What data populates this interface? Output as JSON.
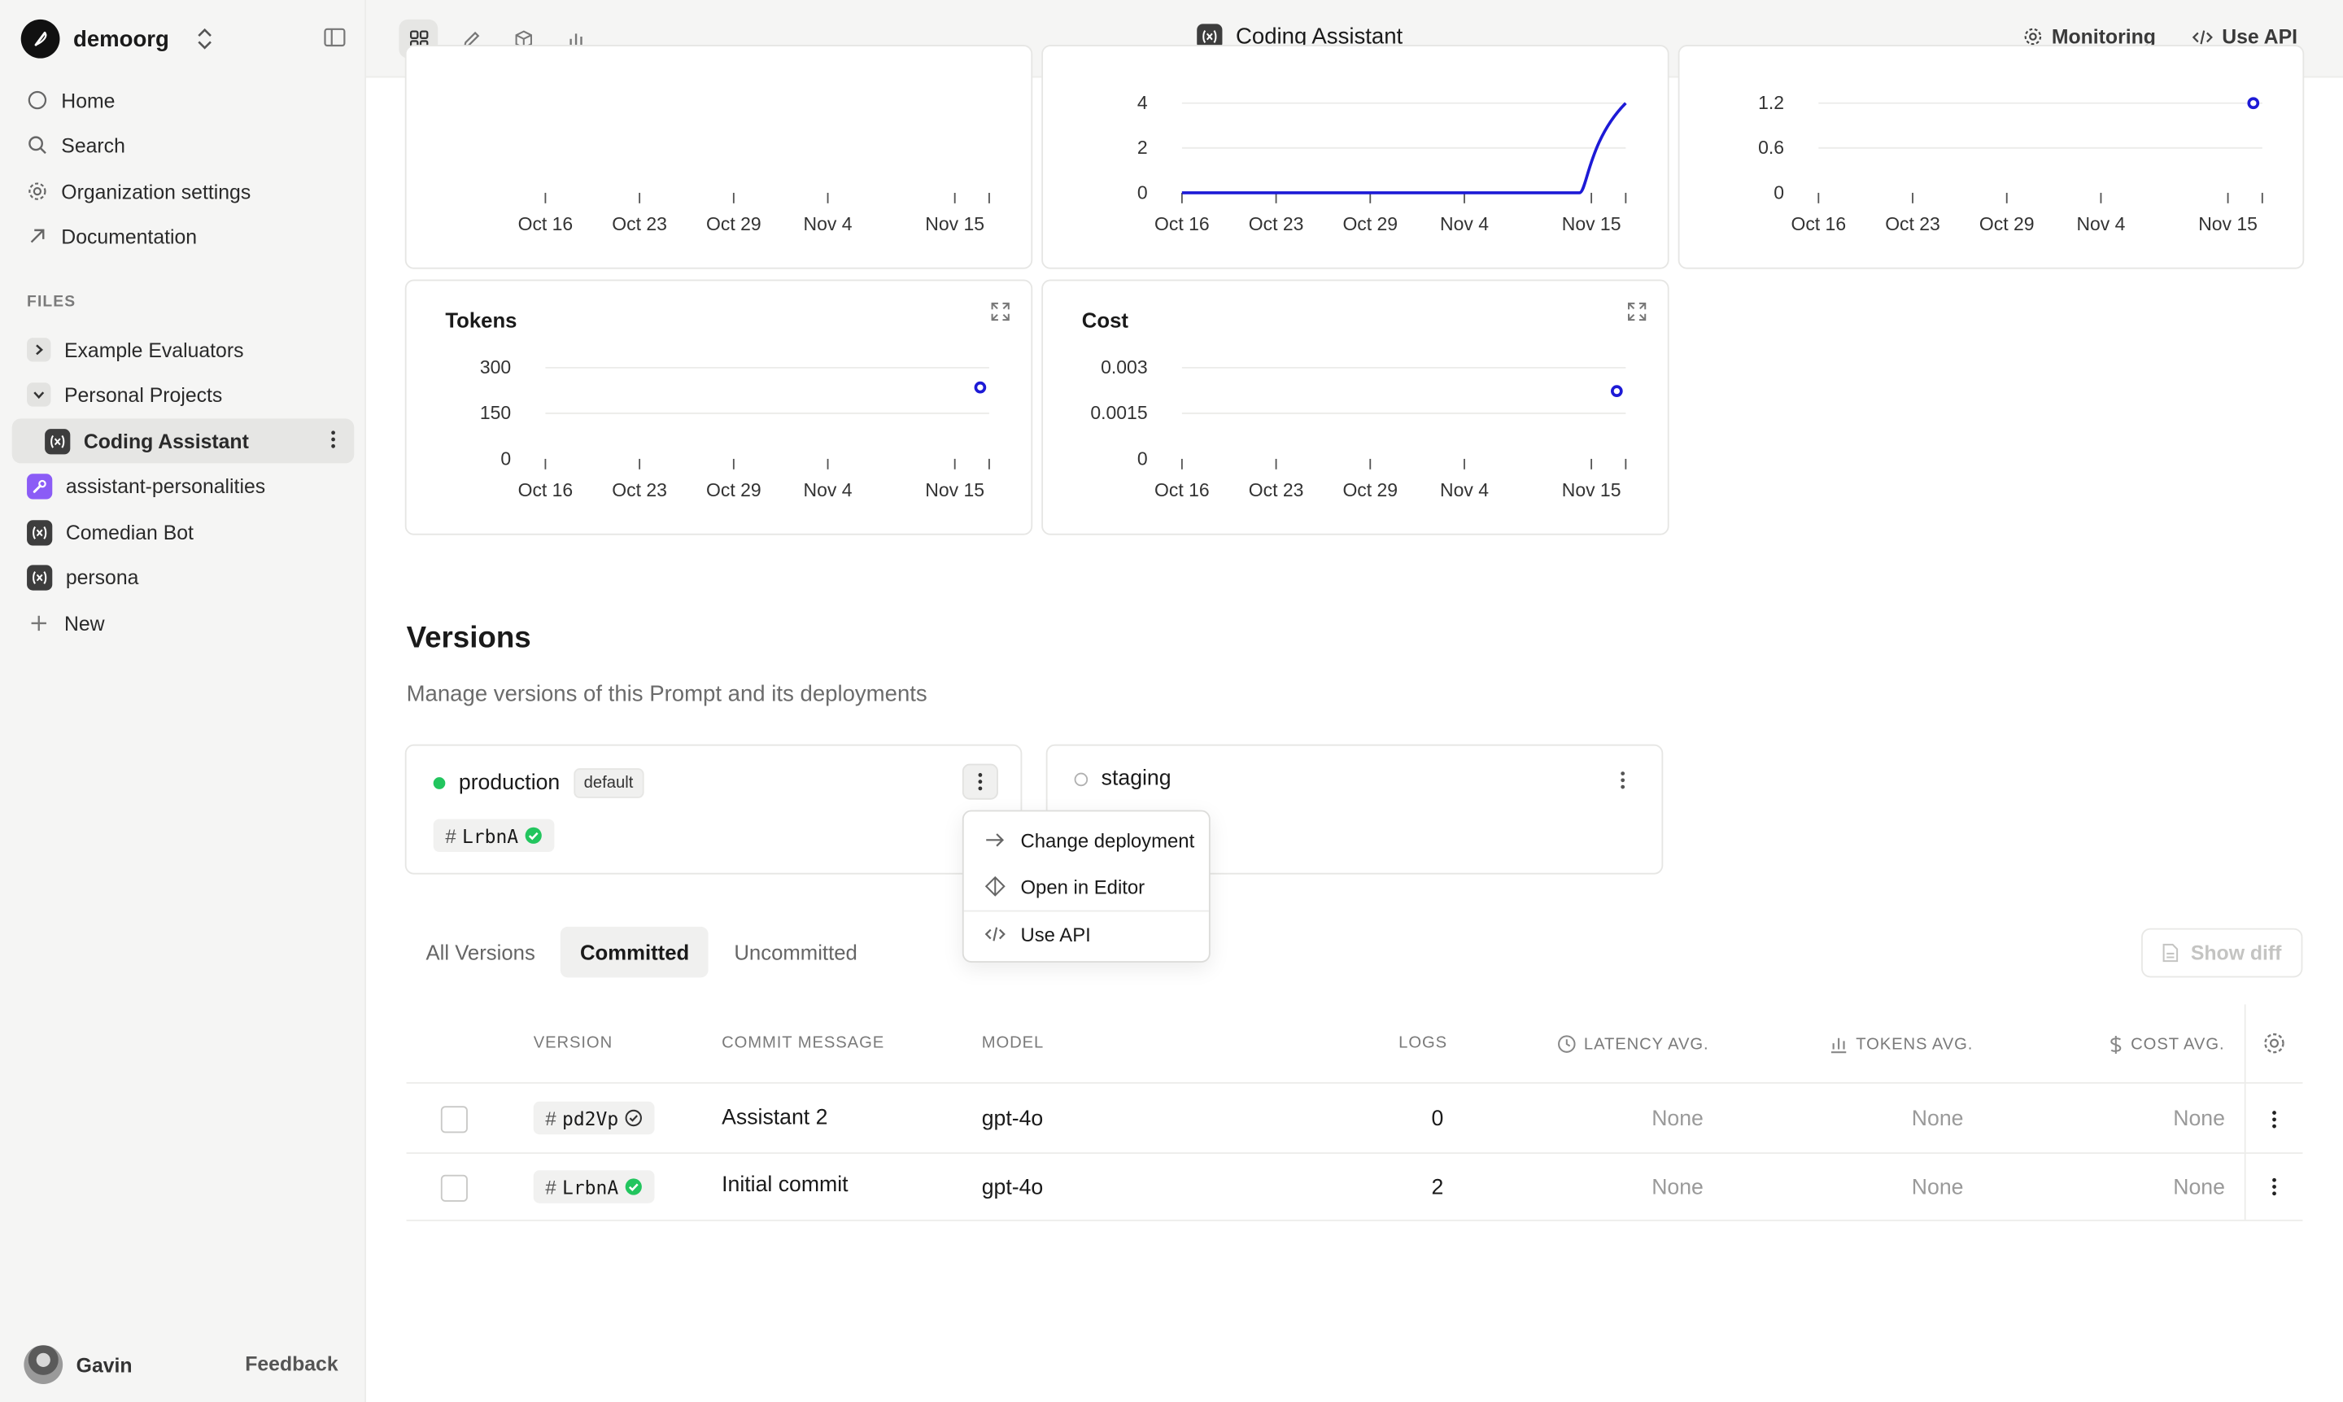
{
  "org": {
    "name": "demoorg"
  },
  "nav": [
    {
      "label": "Home",
      "icon": "circle-icon"
    },
    {
      "label": "Search",
      "icon": "search-icon"
    },
    {
      "label": "Organization settings",
      "icon": "gear-icon"
    },
    {
      "label": "Documentation",
      "icon": "arrow-up-right-icon"
    }
  ],
  "files": {
    "label": "FILES",
    "items": [
      {
        "label": "Example Evaluators",
        "icon": "chevron-right-icon"
      },
      {
        "label": "Personal Projects",
        "icon": "chevron-down-icon"
      },
      {
        "label": "Coding Assistant",
        "icon": "prompt-icon",
        "active": true
      },
      {
        "label": "assistant-personalities",
        "icon": "wrench-icon"
      },
      {
        "label": "Comedian Bot",
        "icon": "prompt-icon"
      },
      {
        "label": "persona",
        "icon": "prompt-icon"
      },
      {
        "label": "New",
        "icon": "plus-icon"
      }
    ]
  },
  "user": {
    "name": "Gavin",
    "feedback": "Feedback"
  },
  "topbar": {
    "title": "Coding Assistant",
    "monitoring": "Monitoring",
    "use_api": "Use API"
  },
  "chart_data": [
    {
      "type": "line",
      "x": [
        "Oct 16",
        "Oct 23",
        "Oct 29",
        "Nov 4",
        "Nov 15"
      ],
      "series": [],
      "xlabel": "",
      "ylabel": ""
    },
    {
      "type": "line",
      "x": [
        "Oct 16",
        "Oct 23",
        "Oct 29",
        "Nov 4",
        "Nov 15"
      ],
      "yticks": [
        "4",
        "2",
        "0"
      ],
      "ylim": [
        0,
        4
      ],
      "series": [
        {
          "color": "#1d1ad6",
          "values": [
            0,
            0,
            0,
            0,
            4
          ]
        }
      ],
      "xlabel": "",
      "ylabel": ""
    },
    {
      "type": "scatter",
      "x": [
        "Oct 16",
        "Oct 23",
        "Oct 29",
        "Nov 4",
        "Nov 15"
      ],
      "yticks": [
        "1.2",
        "0.6",
        "0"
      ],
      "ylim": [
        0,
        1.2
      ],
      "series": [
        {
          "color": "#1d1ad6",
          "points": [
            {
              "x": "Nov 15",
              "y": 1.2
            }
          ]
        }
      ],
      "xlabel": "",
      "ylabel": ""
    },
    {
      "type": "scatter",
      "title": "Tokens",
      "x": [
        "Oct 16",
        "Oct 23",
        "Oct 29",
        "Nov 4",
        "Nov 15"
      ],
      "yticks": [
        "300",
        "150",
        "0"
      ],
      "ylim": [
        0,
        300
      ],
      "series": [
        {
          "color": "#1d1ad6",
          "points": [
            {
              "x": "Nov 15",
              "y": 235
            }
          ]
        }
      ],
      "xlabel": "",
      "ylabel": ""
    },
    {
      "type": "scatter",
      "title": "Cost",
      "x": [
        "Oct 16",
        "Oct 23",
        "Oct 29",
        "Nov 4",
        "Nov 15"
      ],
      "yticks": [
        "0.003",
        "0.0015",
        "0"
      ],
      "ylim": [
        0,
        0.003
      ],
      "series": [
        {
          "color": "#1d1ad6",
          "points": [
            {
              "x": "Nov 15",
              "y": 0.00223
            }
          ]
        }
      ],
      "xlabel": "",
      "ylabel": ""
    }
  ],
  "versions": {
    "title": "Versions",
    "subtitle": "Manage versions of this Prompt and its deployments",
    "deployments": [
      {
        "name": "production",
        "badge": "default",
        "version": "LrbnA",
        "status": "active"
      },
      {
        "name": "staging",
        "status": "inactive"
      }
    ],
    "menu": [
      "Change deployment",
      "Open in Editor",
      "Use API"
    ],
    "tabs": [
      "All Versions",
      "Committed",
      "Uncommitted"
    ],
    "active_tab": "Committed",
    "show_diff": "Show diff",
    "columns": [
      "VERSION",
      "COMMIT MESSAGE",
      "MODEL",
      "LOGS",
      "LATENCY AVG.",
      "TOKENS AVG.",
      "COST AVG."
    ],
    "rows": [
      {
        "version": "pd2Vp",
        "committed": false,
        "message": "Assistant 2",
        "model": "gpt-4o",
        "logs": "0",
        "latency": "None",
        "tokens": "None",
        "cost": "None"
      },
      {
        "version": "LrbnA",
        "committed": true,
        "message": "Initial commit",
        "model": "gpt-4o",
        "logs": "2",
        "latency": "None",
        "tokens": "None",
        "cost": "None"
      }
    ]
  },
  "colors": {
    "accent": "#1d1ad6",
    "green": "#22c55e",
    "sidebar": "#f5f5f4"
  }
}
